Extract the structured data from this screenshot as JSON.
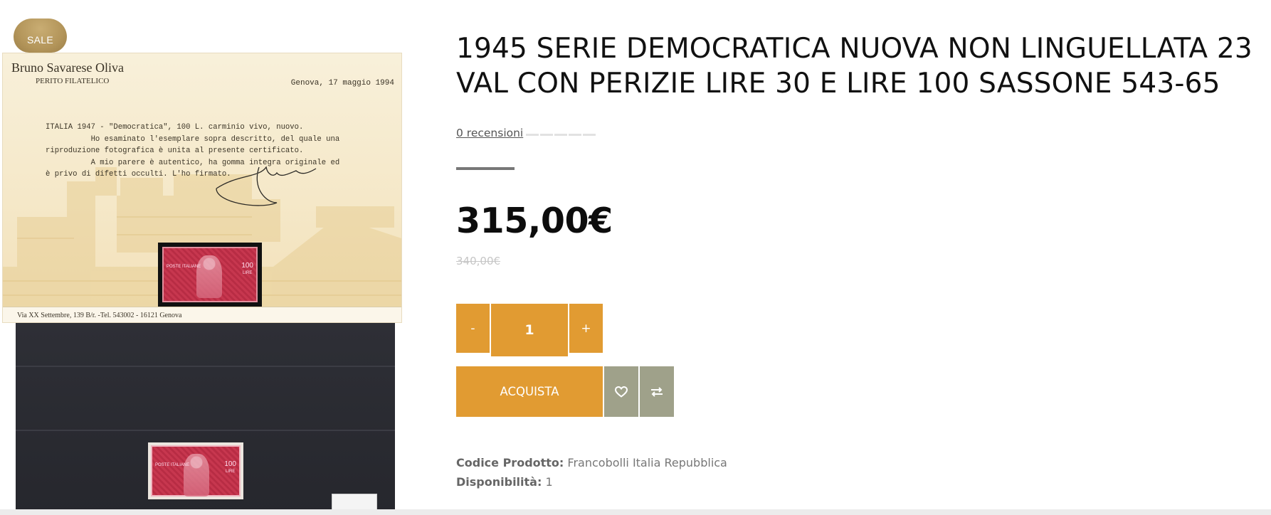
{
  "badge": {
    "sale_label": "SALE"
  },
  "gallery": {
    "certificate": {
      "expert_name": "Bruno Savarese Oliva",
      "expert_role": "PERITO FILATELICO",
      "date_line": "Genova, 17 maggio 1994",
      "body_lines": [
        "ITALIA 1947 - \"Democratica\", 100 L. carminio vivo, nuovo.",
        "          Ho esaminato l'esemplare sopra descritto, del quale una",
        "riproduzione fotografica è unita al presente certificato.",
        "          A mio parere è autentico, ha gomma integra originale ed",
        "è privo di difetti occulti. L'ho firmato."
      ],
      "footer": "Via XX Settembre, 139 B/r. -Tel. 543002 - 16121 Genova",
      "stamp_left_text": "POSTE ITALIANE",
      "stamp_value": "100",
      "stamp_unit": "LIRE"
    }
  },
  "product": {
    "title": "1945 SERIE DEMOCRATICA NUOVA NON LINGUELLATA 23 VAL CON PERIZIE LIRE 30 E LIRE 100 SASSONE 543-65",
    "reviews_link": "0 recensioni",
    "rating": 0,
    "rating_max": 5,
    "price": "315,00€",
    "old_price": "340,00€",
    "quantity": {
      "decrement_label": "-",
      "value": "1",
      "increment_label": "+"
    },
    "buy_label": "ACQUISTA",
    "wishlist_icon": "heart-icon",
    "compare_icon": "exchange-icon",
    "meta": {
      "code_label": "Codice Prodotto:",
      "code_value": "Francobolli Italia Repubblica",
      "availability_label": "Disponibilità:",
      "availability_value": "1"
    }
  },
  "colors": {
    "accent": "#e19b32",
    "secondary_button": "#9fa18a",
    "badge": "#b3955a"
  }
}
